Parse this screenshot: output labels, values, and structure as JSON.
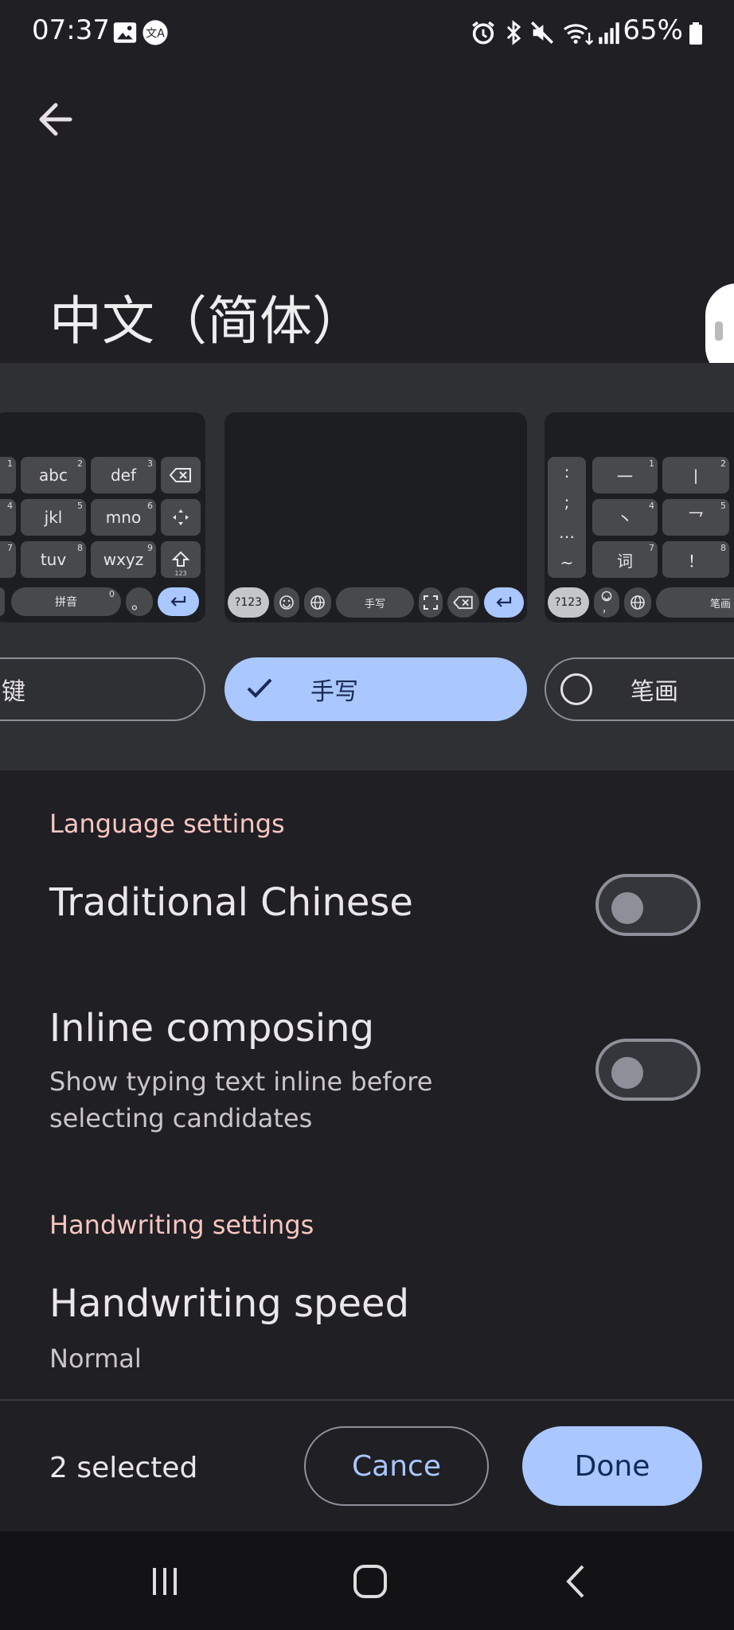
{
  "status_bar": {
    "time": "07:37",
    "battery": "65%",
    "icons": [
      "gallery-icon",
      "translate-icon",
      "alarm-icon",
      "bluetooth-icon",
      "mute-icon",
      "wifi-icon",
      "signal-icon",
      "battery-icon"
    ]
  },
  "header": {
    "title": "中文（简体）"
  },
  "layouts": {
    "left_keyboard": {
      "rows": [
        [
          {
            "label": "abc",
            "num": "2"
          },
          {
            "label": "def",
            "num": "3"
          }
        ],
        [
          {
            "label": "jkl",
            "num": "5"
          },
          {
            "label": "mno",
            "num": "6"
          }
        ],
        [
          {
            "label": "tuv",
            "num": "8"
          },
          {
            "label": "wxyz",
            "num": "9"
          }
        ]
      ],
      "row0_left_num": "1",
      "row1_left_num": "4",
      "row2_left_num": "7",
      "shift_small": "123",
      "space_label": "拼音",
      "space_num": "0",
      "period": "。"
    },
    "center_keyboard": {
      "sym_label": "?123",
      "space_label": "手写"
    },
    "right_keyboard": {
      "side_keys": [
        ":",
        ";",
        "…",
        "~"
      ],
      "stroke_keys": [
        {
          "label": "一",
          "num": "1"
        },
        {
          "label": "丨",
          "num": "2"
        },
        {
          "label": "丶",
          "num": "4"
        },
        {
          "label": "乛",
          "num": "5"
        },
        {
          "label": "词",
          "num": "7"
        },
        {
          "label": "！",
          "num": "8"
        }
      ],
      "sym_label": "?123",
      "emoji_comma": "，",
      "space_label": "笔画"
    },
    "chips": {
      "left": "键",
      "center": "手写",
      "right": "笔画"
    }
  },
  "settings": {
    "language_section": "Language settings",
    "traditional_chinese": {
      "title": "Traditional Chinese",
      "enabled": false
    },
    "inline_composing": {
      "title": "Inline composing",
      "subtitle_line1": "Show typing text inline before",
      "subtitle_line2": "selecting candidates",
      "enabled": false
    },
    "handwriting_section": "Handwriting settings",
    "handwriting_speed": {
      "title": "Handwriting speed",
      "value": "Normal"
    }
  },
  "action_bar": {
    "selected_count": "2 selected",
    "cancel_label": "Cance",
    "done_label": "Done"
  },
  "colors": {
    "background": "#1f1f24",
    "accent": "#aac7ff",
    "section_header": "#f7c6c0"
  }
}
